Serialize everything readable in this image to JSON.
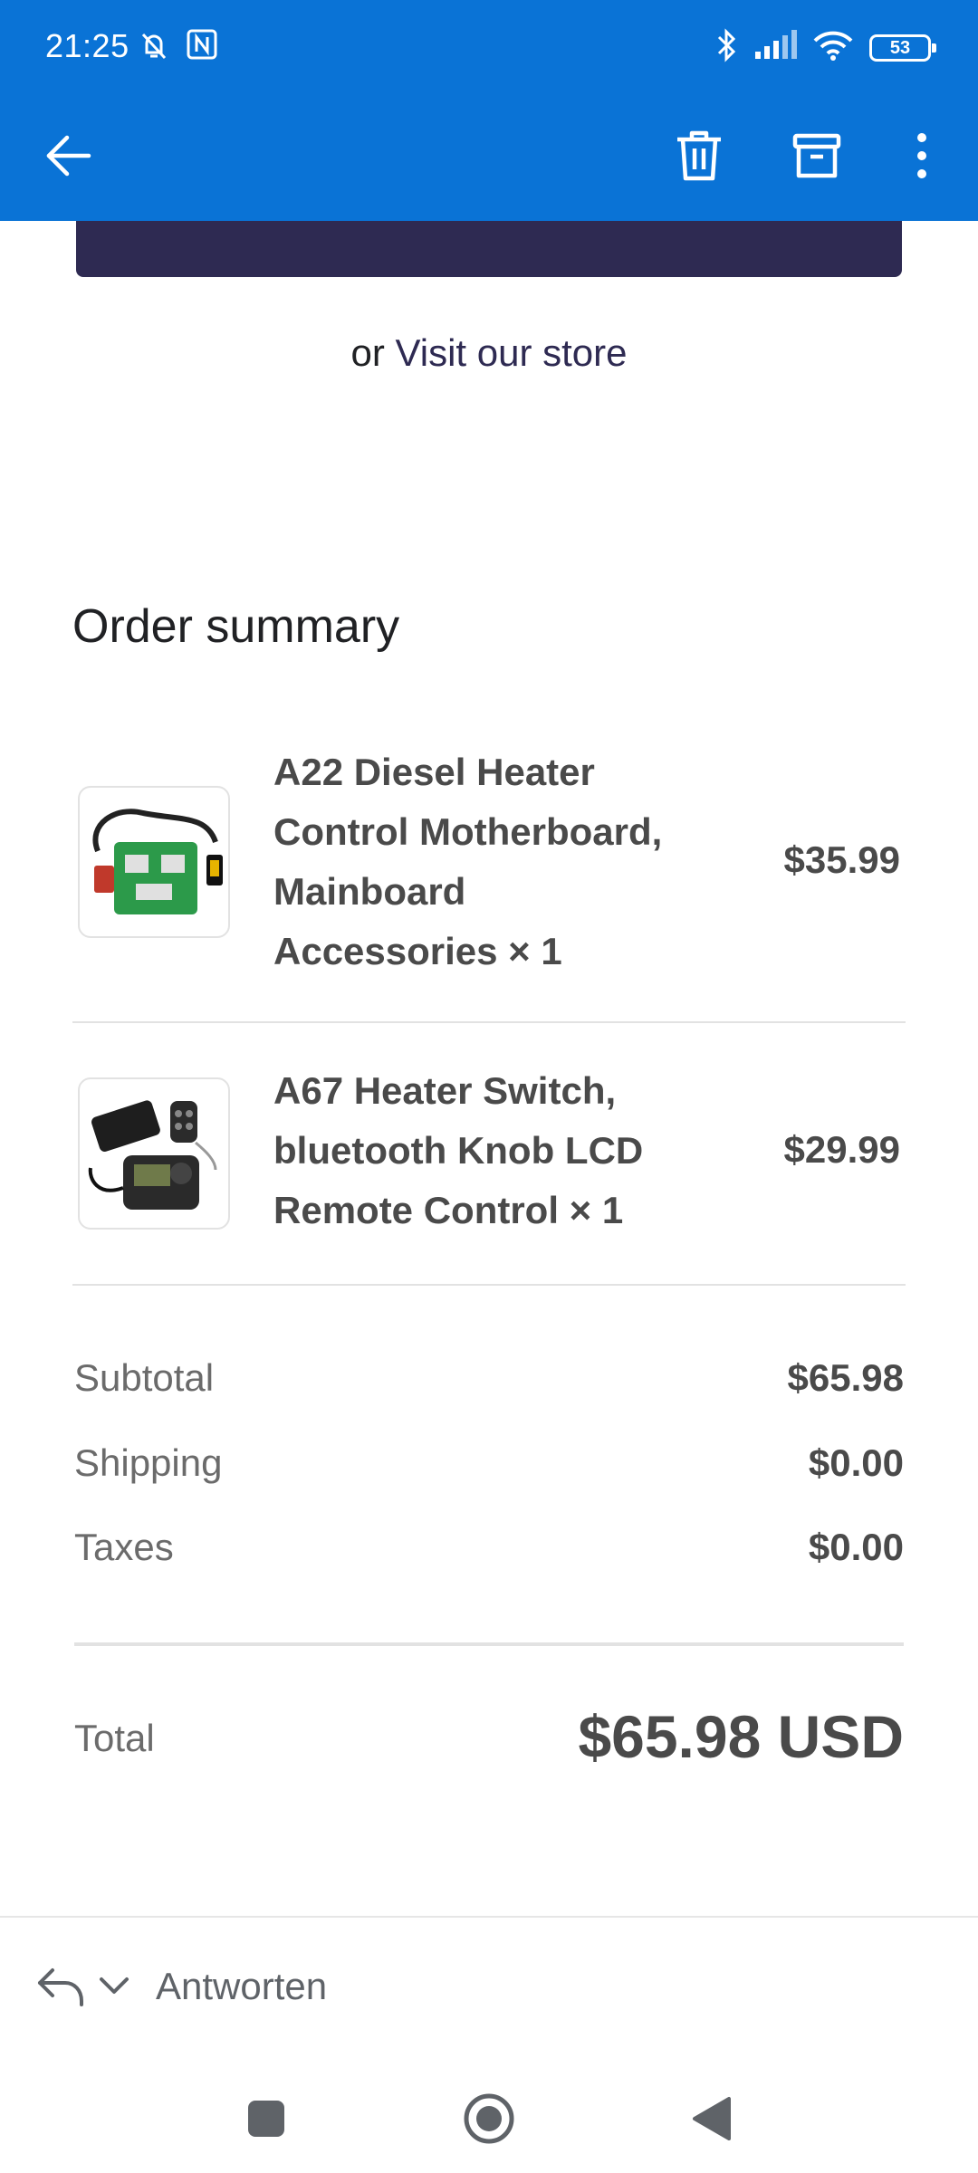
{
  "status_bar": {
    "time": "21:25",
    "battery": "53"
  },
  "toolbar": {
    "back_icon": "arrow-left-icon",
    "delete_icon": "trash-icon",
    "archive_icon": "archive-icon",
    "more_icon": "more-vertical-icon"
  },
  "visit": {
    "prefix": "or ",
    "link": "Visit our store"
  },
  "summary": {
    "title": "Order summary",
    "items": [
      {
        "name_lines": [
          "A22 Diesel Heater",
          "Control Motherboard,",
          "Mainboard",
          "Accessories × 1"
        ],
        "price": "$35.99"
      },
      {
        "name_lines": [
          "A67 Heater Switch,",
          "bluetooth Knob LCD",
          "Remote Control × 1"
        ],
        "price": "$29.99"
      }
    ],
    "subtotal_label": "Subtotal",
    "subtotal_value": "$65.98",
    "shipping_label": "Shipping",
    "shipping_value": "$0.00",
    "taxes_label": "Taxes",
    "taxes_value": "$0.00",
    "total_label": "Total",
    "total_value": "$65.98 USD"
  },
  "reply": {
    "label": "Antworten"
  },
  "colors": {
    "appbar": "#0a73d6",
    "cta": "#2e2a52"
  }
}
